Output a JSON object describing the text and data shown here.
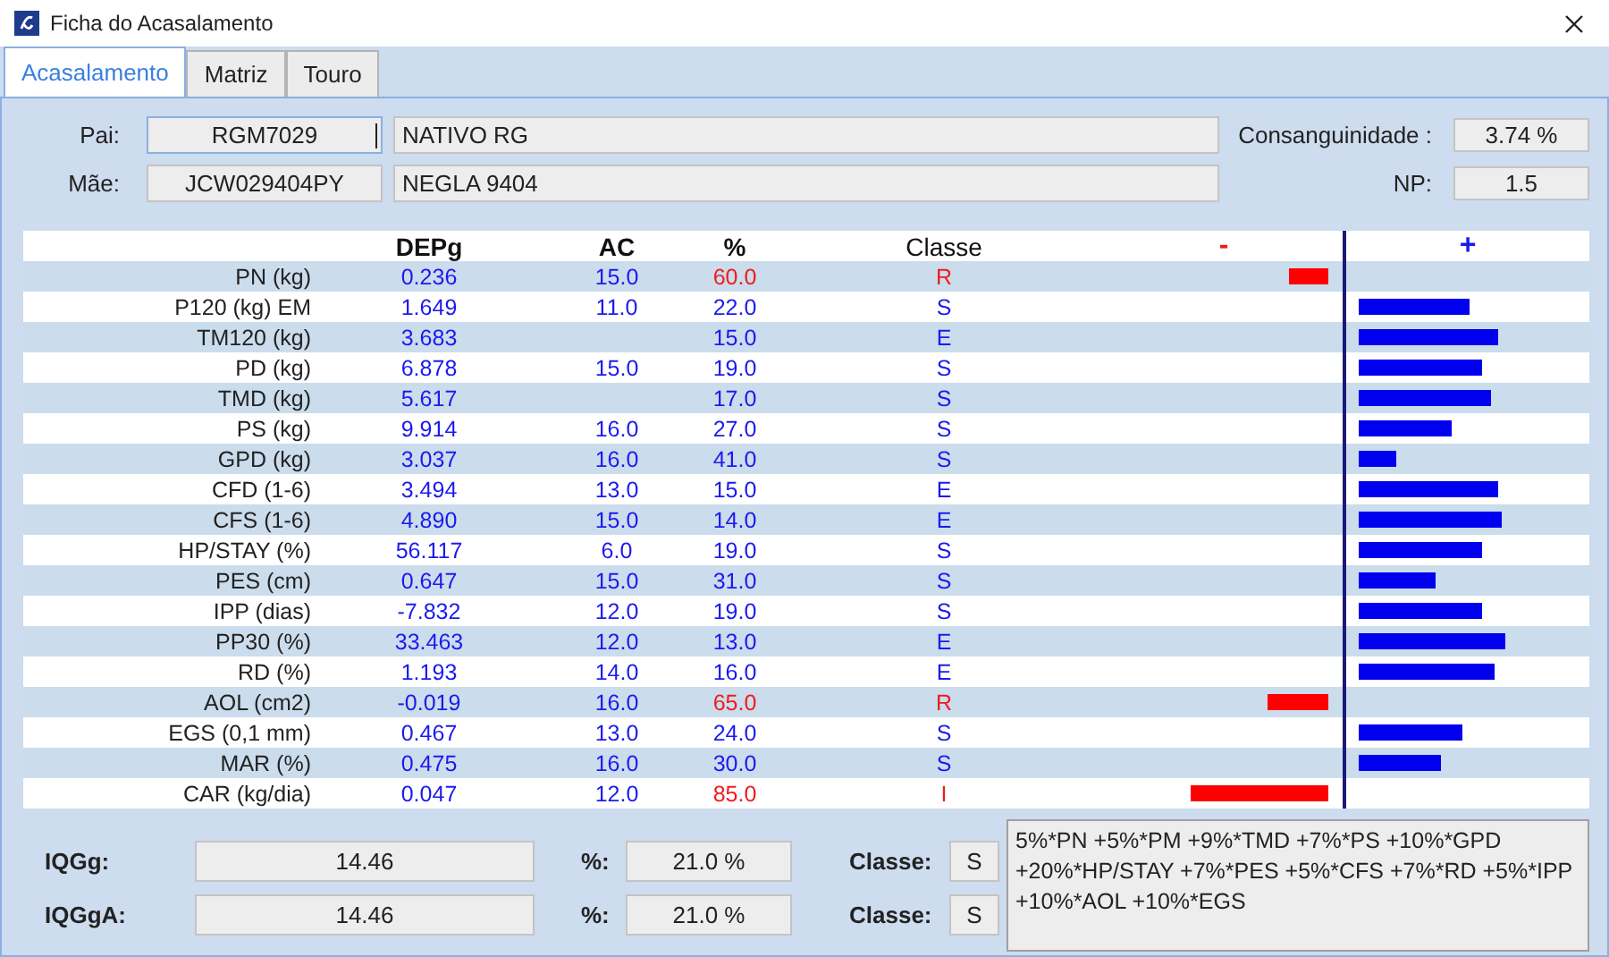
{
  "window": {
    "title": "Ficha do Acasalamento"
  },
  "tabs": [
    {
      "label": "Acasalamento",
      "selected": true
    },
    {
      "label": "Matriz",
      "selected": false
    },
    {
      "label": "Touro",
      "selected": false
    }
  ],
  "parents": [
    {
      "label": "Pai:",
      "code": "RGM7029",
      "name": "NATIVO RG",
      "focused": true
    },
    {
      "label": "Mãe:",
      "code": "JCW029404PY",
      "name": "NEGLA 9404",
      "focused": false
    }
  ],
  "stats": [
    {
      "label": "Consanguinidade :",
      "value": "3.74 %"
    },
    {
      "label": "NP:",
      "value": "1.5"
    }
  ],
  "table": {
    "columns": [
      "DEPg",
      "AC",
      "%",
      "Classe"
    ],
    "minus": "-",
    "plus": "+",
    "rows": [
      {
        "trait": "PN (kg)",
        "depg": "0.236",
        "ac": "15.0",
        "pct": "60.0",
        "classe": "R",
        "alert": true,
        "bar": {
          "kind": "negative"
        }
      },
      {
        "trait": "P120 (kg) EM",
        "depg": "1.649",
        "ac": "11.0",
        "pct": "22.0",
        "classe": "S",
        "alert": false,
        "bar": {
          "kind": "positive"
        }
      },
      {
        "trait": "TM120 (kg)",
        "depg": "3.683",
        "pct": "15.0",
        "classe": "E",
        "alert": false,
        "bar": {
          "kind": "positive"
        }
      },
      {
        "trait": "PD (kg)",
        "depg": "6.878",
        "ac": "15.0",
        "pct": "19.0",
        "classe": "S",
        "alert": false,
        "bar": {
          "kind": "positive"
        }
      },
      {
        "trait": "TMD (kg)",
        "depg": "5.617",
        "pct": "17.0",
        "classe": "S",
        "alert": false,
        "bar": {
          "kind": "positive"
        }
      },
      {
        "trait": "PS (kg)",
        "depg": "9.914",
        "ac": "16.0",
        "pct": "27.0",
        "classe": "S",
        "alert": false,
        "bar": {
          "kind": "positive"
        }
      },
      {
        "trait": "GPD (kg)",
        "depg": "3.037",
        "ac": "16.0",
        "pct": "41.0",
        "classe": "S",
        "alert": false,
        "bar": {
          "kind": "positive"
        }
      },
      {
        "trait": "CFD (1-6)",
        "depg": "3.494",
        "ac": "13.0",
        "pct": "15.0",
        "classe": "E",
        "alert": false,
        "bar": {
          "kind": "positive"
        }
      },
      {
        "trait": "CFS (1-6)",
        "depg": "4.890",
        "ac": "15.0",
        "pct": "14.0",
        "classe": "E",
        "alert": false,
        "bar": {
          "kind": "positive"
        }
      },
      {
        "trait": "HP/STAY (%)",
        "depg": "56.117",
        "ac": "6.0",
        "pct": "19.0",
        "classe": "S",
        "alert": false,
        "bar": {
          "kind": "positive"
        }
      },
      {
        "trait": "PES (cm)",
        "depg": "0.647",
        "ac": "15.0",
        "pct": "31.0",
        "classe": "S",
        "alert": false,
        "bar": {
          "kind": "positive"
        }
      },
      {
        "trait": "IPP (dias)",
        "depg": "-7.832",
        "ac": "12.0",
        "pct": "19.0",
        "classe": "S",
        "alert": false,
        "bar": {
          "kind": "positive"
        }
      },
      {
        "trait": "PP30 (%)",
        "depg": "33.463",
        "ac": "12.0",
        "pct": "13.0",
        "classe": "E",
        "alert": false,
        "bar": {
          "kind": "positive"
        }
      },
      {
        "trait": "RD (%)",
        "depg": "1.193",
        "ac": "14.0",
        "pct": "16.0",
        "classe": "E",
        "alert": false,
        "bar": {
          "kind": "positive"
        }
      },
      {
        "trait": "AOL (cm2)",
        "depg": "-0.019",
        "ac": "16.0",
        "pct": "65.0",
        "classe": "R",
        "alert": true,
        "bar": {
          "kind": "negative"
        }
      },
      {
        "trait": "EGS (0,1 mm)",
        "depg": "0.467",
        "ac": "13.0",
        "pct": "24.0",
        "classe": "S",
        "alert": false,
        "bar": {
          "kind": "positive"
        }
      },
      {
        "trait": "MAR (%)",
        "depg": "0.475",
        "ac": "16.0",
        "pct": "30.0",
        "classe": "S",
        "alert": false,
        "bar": {
          "kind": "positive"
        }
      },
      {
        "trait": "CAR (kg/dia)",
        "depg": "0.047",
        "ac": "12.0",
        "pct": "85.0",
        "classe": "I",
        "alert": true,
        "bar": {
          "kind": "negative"
        }
      }
    ]
  },
  "indices": [
    {
      "label": "IQGg:",
      "value": "14.46",
      "pct_label": "%:",
      "pct": "21.0 %",
      "class_label": "Classe:",
      "classe": "S"
    },
    {
      "label": "IQGgA:",
      "value": "14.46",
      "pct_label": "%:",
      "pct": "21.0 %",
      "class_label": "Classe:",
      "classe": "S"
    }
  ],
  "formula": "5%*PN +5%*PM +9%*TMD +7%*PS +10%*GPD +20%*HP/STAY +7%*PES +5%*CFS +7%*RD +5%*IPP +10%*AOL +10%*EGS"
}
